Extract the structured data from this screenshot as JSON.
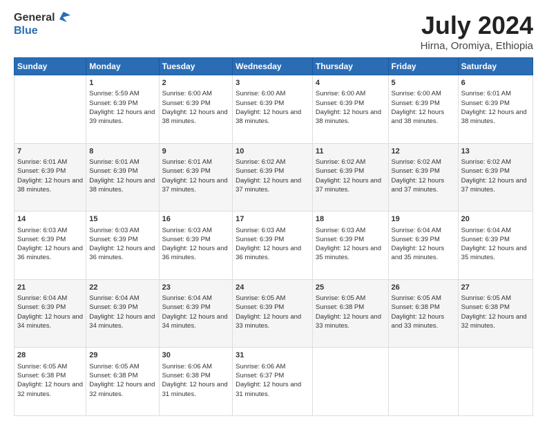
{
  "header": {
    "logo_general": "General",
    "logo_blue": "Blue",
    "title": "July 2024",
    "subtitle": "Hirna, Oromiya, Ethiopia"
  },
  "days_of_week": [
    "Sunday",
    "Monday",
    "Tuesday",
    "Wednesday",
    "Thursday",
    "Friday",
    "Saturday"
  ],
  "weeks": [
    [
      {
        "day": "",
        "sunrise": "",
        "sunset": "",
        "daylight": ""
      },
      {
        "day": "1",
        "sunrise": "Sunrise: 5:59 AM",
        "sunset": "Sunset: 6:39 PM",
        "daylight": "Daylight: 12 hours and 39 minutes."
      },
      {
        "day": "2",
        "sunrise": "Sunrise: 6:00 AM",
        "sunset": "Sunset: 6:39 PM",
        "daylight": "Daylight: 12 hours and 38 minutes."
      },
      {
        "day": "3",
        "sunrise": "Sunrise: 6:00 AM",
        "sunset": "Sunset: 6:39 PM",
        "daylight": "Daylight: 12 hours and 38 minutes."
      },
      {
        "day": "4",
        "sunrise": "Sunrise: 6:00 AM",
        "sunset": "Sunset: 6:39 PM",
        "daylight": "Daylight: 12 hours and 38 minutes."
      },
      {
        "day": "5",
        "sunrise": "Sunrise: 6:00 AM",
        "sunset": "Sunset: 6:39 PM",
        "daylight": "Daylight: 12 hours and 38 minutes."
      },
      {
        "day": "6",
        "sunrise": "Sunrise: 6:01 AM",
        "sunset": "Sunset: 6:39 PM",
        "daylight": "Daylight: 12 hours and 38 minutes."
      }
    ],
    [
      {
        "day": "7",
        "sunrise": "Sunrise: 6:01 AM",
        "sunset": "Sunset: 6:39 PM",
        "daylight": "Daylight: 12 hours and 38 minutes."
      },
      {
        "day": "8",
        "sunrise": "Sunrise: 6:01 AM",
        "sunset": "Sunset: 6:39 PM",
        "daylight": "Daylight: 12 hours and 38 minutes."
      },
      {
        "day": "9",
        "sunrise": "Sunrise: 6:01 AM",
        "sunset": "Sunset: 6:39 PM",
        "daylight": "Daylight: 12 hours and 37 minutes."
      },
      {
        "day": "10",
        "sunrise": "Sunrise: 6:02 AM",
        "sunset": "Sunset: 6:39 PM",
        "daylight": "Daylight: 12 hours and 37 minutes."
      },
      {
        "day": "11",
        "sunrise": "Sunrise: 6:02 AM",
        "sunset": "Sunset: 6:39 PM",
        "daylight": "Daylight: 12 hours and 37 minutes."
      },
      {
        "day": "12",
        "sunrise": "Sunrise: 6:02 AM",
        "sunset": "Sunset: 6:39 PM",
        "daylight": "Daylight: 12 hours and 37 minutes."
      },
      {
        "day": "13",
        "sunrise": "Sunrise: 6:02 AM",
        "sunset": "Sunset: 6:39 PM",
        "daylight": "Daylight: 12 hours and 37 minutes."
      }
    ],
    [
      {
        "day": "14",
        "sunrise": "Sunrise: 6:03 AM",
        "sunset": "Sunset: 6:39 PM",
        "daylight": "Daylight: 12 hours and 36 minutes."
      },
      {
        "day": "15",
        "sunrise": "Sunrise: 6:03 AM",
        "sunset": "Sunset: 6:39 PM",
        "daylight": "Daylight: 12 hours and 36 minutes."
      },
      {
        "day": "16",
        "sunrise": "Sunrise: 6:03 AM",
        "sunset": "Sunset: 6:39 PM",
        "daylight": "Daylight: 12 hours and 36 minutes."
      },
      {
        "day": "17",
        "sunrise": "Sunrise: 6:03 AM",
        "sunset": "Sunset: 6:39 PM",
        "daylight": "Daylight: 12 hours and 36 minutes."
      },
      {
        "day": "18",
        "sunrise": "Sunrise: 6:03 AM",
        "sunset": "Sunset: 6:39 PM",
        "daylight": "Daylight: 12 hours and 35 minutes."
      },
      {
        "day": "19",
        "sunrise": "Sunrise: 6:04 AM",
        "sunset": "Sunset: 6:39 PM",
        "daylight": "Daylight: 12 hours and 35 minutes."
      },
      {
        "day": "20",
        "sunrise": "Sunrise: 6:04 AM",
        "sunset": "Sunset: 6:39 PM",
        "daylight": "Daylight: 12 hours and 35 minutes."
      }
    ],
    [
      {
        "day": "21",
        "sunrise": "Sunrise: 6:04 AM",
        "sunset": "Sunset: 6:39 PM",
        "daylight": "Daylight: 12 hours and 34 minutes."
      },
      {
        "day": "22",
        "sunrise": "Sunrise: 6:04 AM",
        "sunset": "Sunset: 6:39 PM",
        "daylight": "Daylight: 12 hours and 34 minutes."
      },
      {
        "day": "23",
        "sunrise": "Sunrise: 6:04 AM",
        "sunset": "Sunset: 6:39 PM",
        "daylight": "Daylight: 12 hours and 34 minutes."
      },
      {
        "day": "24",
        "sunrise": "Sunrise: 6:05 AM",
        "sunset": "Sunset: 6:39 PM",
        "daylight": "Daylight: 12 hours and 33 minutes."
      },
      {
        "day": "25",
        "sunrise": "Sunrise: 6:05 AM",
        "sunset": "Sunset: 6:38 PM",
        "daylight": "Daylight: 12 hours and 33 minutes."
      },
      {
        "day": "26",
        "sunrise": "Sunrise: 6:05 AM",
        "sunset": "Sunset: 6:38 PM",
        "daylight": "Daylight: 12 hours and 33 minutes."
      },
      {
        "day": "27",
        "sunrise": "Sunrise: 6:05 AM",
        "sunset": "Sunset: 6:38 PM",
        "daylight": "Daylight: 12 hours and 32 minutes."
      }
    ],
    [
      {
        "day": "28",
        "sunrise": "Sunrise: 6:05 AM",
        "sunset": "Sunset: 6:38 PM",
        "daylight": "Daylight: 12 hours and 32 minutes."
      },
      {
        "day": "29",
        "sunrise": "Sunrise: 6:05 AM",
        "sunset": "Sunset: 6:38 PM",
        "daylight": "Daylight: 12 hours and 32 minutes."
      },
      {
        "day": "30",
        "sunrise": "Sunrise: 6:06 AM",
        "sunset": "Sunset: 6:38 PM",
        "daylight": "Daylight: 12 hours and 31 minutes."
      },
      {
        "day": "31",
        "sunrise": "Sunrise: 6:06 AM",
        "sunset": "Sunset: 6:37 PM",
        "daylight": "Daylight: 12 hours and 31 minutes."
      },
      {
        "day": "",
        "sunrise": "",
        "sunset": "",
        "daylight": ""
      },
      {
        "day": "",
        "sunrise": "",
        "sunset": "",
        "daylight": ""
      },
      {
        "day": "",
        "sunrise": "",
        "sunset": "",
        "daylight": ""
      }
    ]
  ]
}
